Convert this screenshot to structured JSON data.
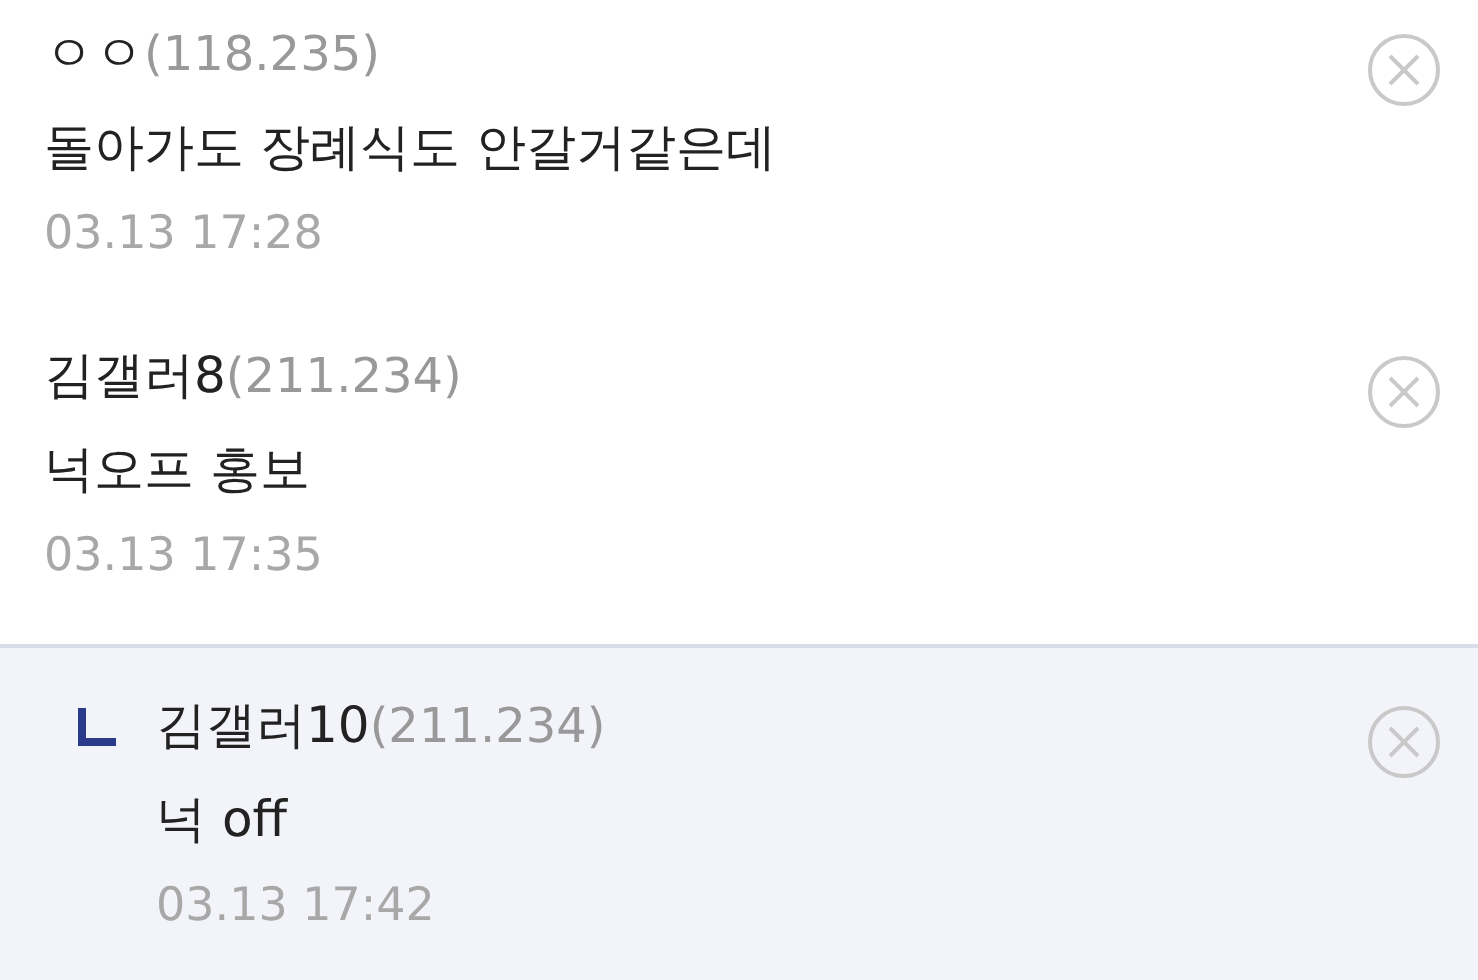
{
  "comments": [
    {
      "kind": "comment",
      "name": "ㅇㅇ",
      "ip": "(118.235)",
      "text": "돌아가도 장례식도 안갈거같은데",
      "date": "03.13 17:28"
    },
    {
      "kind": "comment",
      "name": "김갤러8",
      "ip": "(211.234)",
      "text": "넉오프 홍보",
      "date": "03.13 17:35"
    },
    {
      "kind": "reply",
      "name": "김갤러10",
      "ip": "(211.234)",
      "text": "넉 off",
      "date": "03.13 17:42"
    }
  ]
}
